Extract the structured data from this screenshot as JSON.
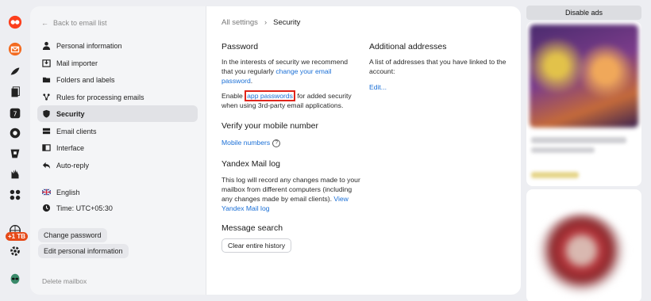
{
  "colors": {
    "accent_link": "#1a6fd6",
    "active_bg": "#e1e2e6",
    "highlight": "#e0241b",
    "badge": "#e64a19"
  },
  "rail": {
    "icons": [
      "yandex-logo-icon",
      "mail-icon",
      "disk-icon",
      "notes-icon",
      "messenger-icon",
      "telemost-icon",
      "calendar-icon",
      "contacts-icon",
      "apps-grid-icon",
      "globe-plus-icon",
      "settings-gear-icon",
      "alien-avatar-icon"
    ],
    "storage_badge": "+1 TB"
  },
  "menu": {
    "back_label": "Back to email list",
    "items": [
      {
        "label": "Personal information",
        "icon": "person-icon"
      },
      {
        "label": "Mail importer",
        "icon": "import-icon"
      },
      {
        "label": "Folders and labels",
        "icon": "folder-icon"
      },
      {
        "label": "Rules for processing emails",
        "icon": "rules-icon"
      },
      {
        "label": "Security",
        "icon": "shield-icon",
        "active": true
      },
      {
        "label": "Email clients",
        "icon": "server-icon"
      },
      {
        "label": "Interface",
        "icon": "interface-icon"
      },
      {
        "label": "Auto-reply",
        "icon": "reply-icon"
      }
    ],
    "language": "English",
    "time": "Time: UTC+05:30",
    "change_password": "Change password",
    "edit_personal": "Edit personal information",
    "delete_mailbox": "Delete mailbox"
  },
  "main": {
    "breadcrumb_root": "All settings",
    "breadcrumb_sep": "›",
    "breadcrumb_current": "Security",
    "password": {
      "title": "Password",
      "text1": "In the interests of security we recommend that you regularly",
      "link1": "change your email password",
      "text1_end": ".",
      "text2_start": "Enable",
      "link2": "app passwords",
      "text2_end": "for added security when using 3rd-party email applications."
    },
    "additional": {
      "title": "Additional addresses",
      "text": "A list of addresses that you have linked to the account:",
      "link": "Edit..."
    },
    "verify": {
      "title": "Verify your mobile number",
      "link": "Mobile numbers",
      "help": "?"
    },
    "log": {
      "title": "Yandex Mail log",
      "text": "This log will record any changes made to your mailbox from different computers (including any changes made by email clients).",
      "link": "View Yandex Mail log"
    },
    "search": {
      "title": "Message search",
      "button": "Clear entire history"
    }
  },
  "ads": {
    "disable_label": "Disable ads"
  }
}
